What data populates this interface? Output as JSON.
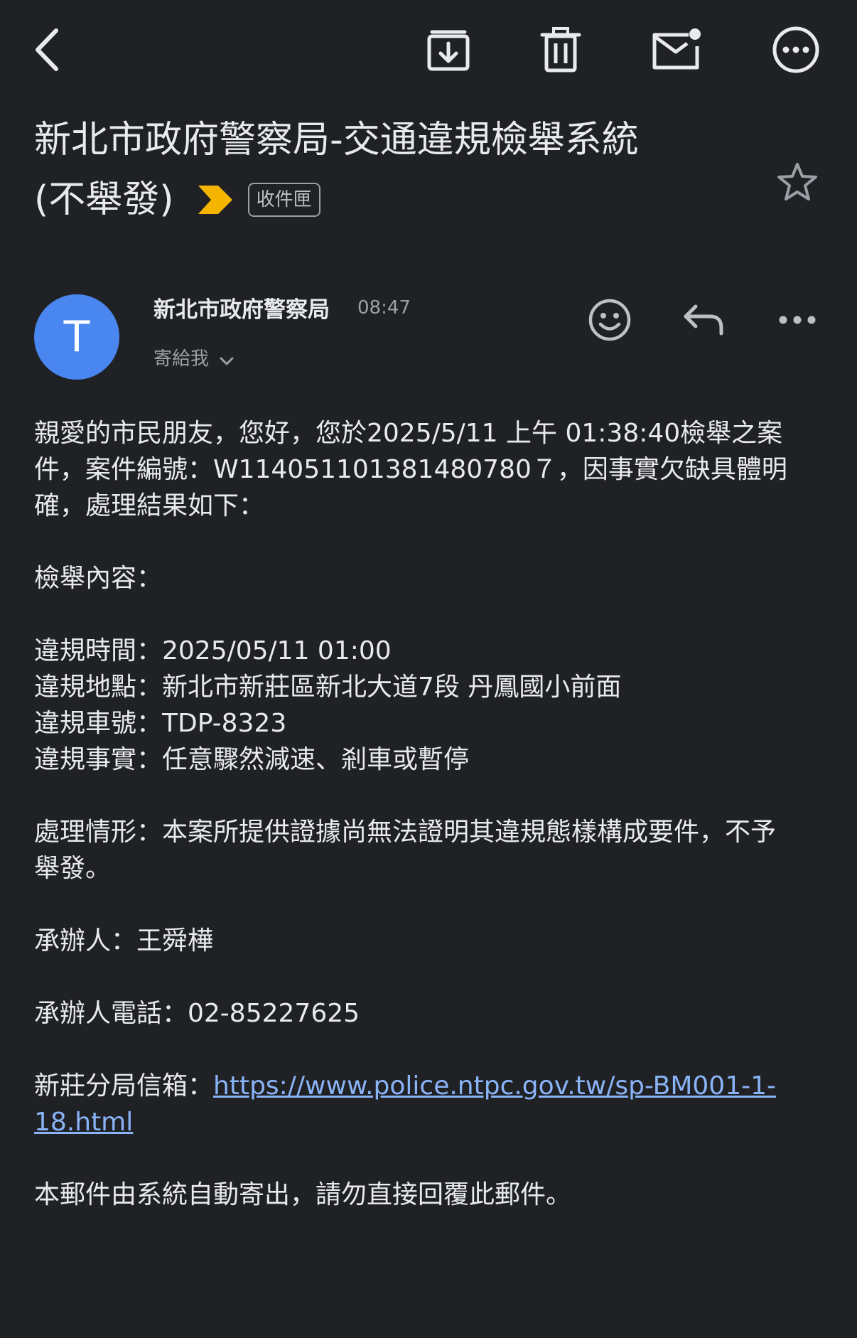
{
  "toolbar": {
    "back_icon": "back-arrow-icon",
    "archive_icon": "archive-icon",
    "delete_icon": "trash-icon",
    "mark_unread_icon": "mail-unread-icon",
    "more_icon": "more-circle-icon"
  },
  "subject": {
    "line1": "新北市政府警察局-交通違規檢舉系統",
    "line2": "(不舉發)",
    "label": "收件匣",
    "importance_color": "#f4b400"
  },
  "sender": {
    "avatar_letter": "T",
    "avatar_color": "#4a86f0",
    "name": "新北市政府警察局",
    "time": "08:47",
    "recipient": "寄給我"
  },
  "body": {
    "line1": "親愛的市民朋友，您好，您於2025/5/11 上午 01:38:40檢舉之案",
    "line2": "件，案件編號：W114051101381480780７，因事實欠缺具體明",
    "line3": "確，處理結果如下：",
    "content_heading": "檢舉內容：",
    "time_row": "違規時間：2025/05/11 01:00",
    "place_row": "違規地點：新北市新莊區新北大道7段 丹鳳國小前面",
    "plate_row": "違規車號：TDP-8323",
    "fact_row": "違規事實：任意驟然減速、剎車或暫停",
    "handling_line1": "處理情形：本案所提供證據尚無法證明其違規態樣構成要件，不予",
    "handling_line2": "舉發。",
    "handler": "承辦人：王舜樺",
    "phone": "承辦人電話：02-85227625",
    "mailbox_label": "新莊分局信箱：",
    "mailbox_link_line1": "https://www.police.ntpc.gov.tw/sp-BM001-1-",
    "mailbox_link_line2": "18.html",
    "footer": "本郵件由系統自動寄出，請勿直接回覆此郵件。"
  }
}
